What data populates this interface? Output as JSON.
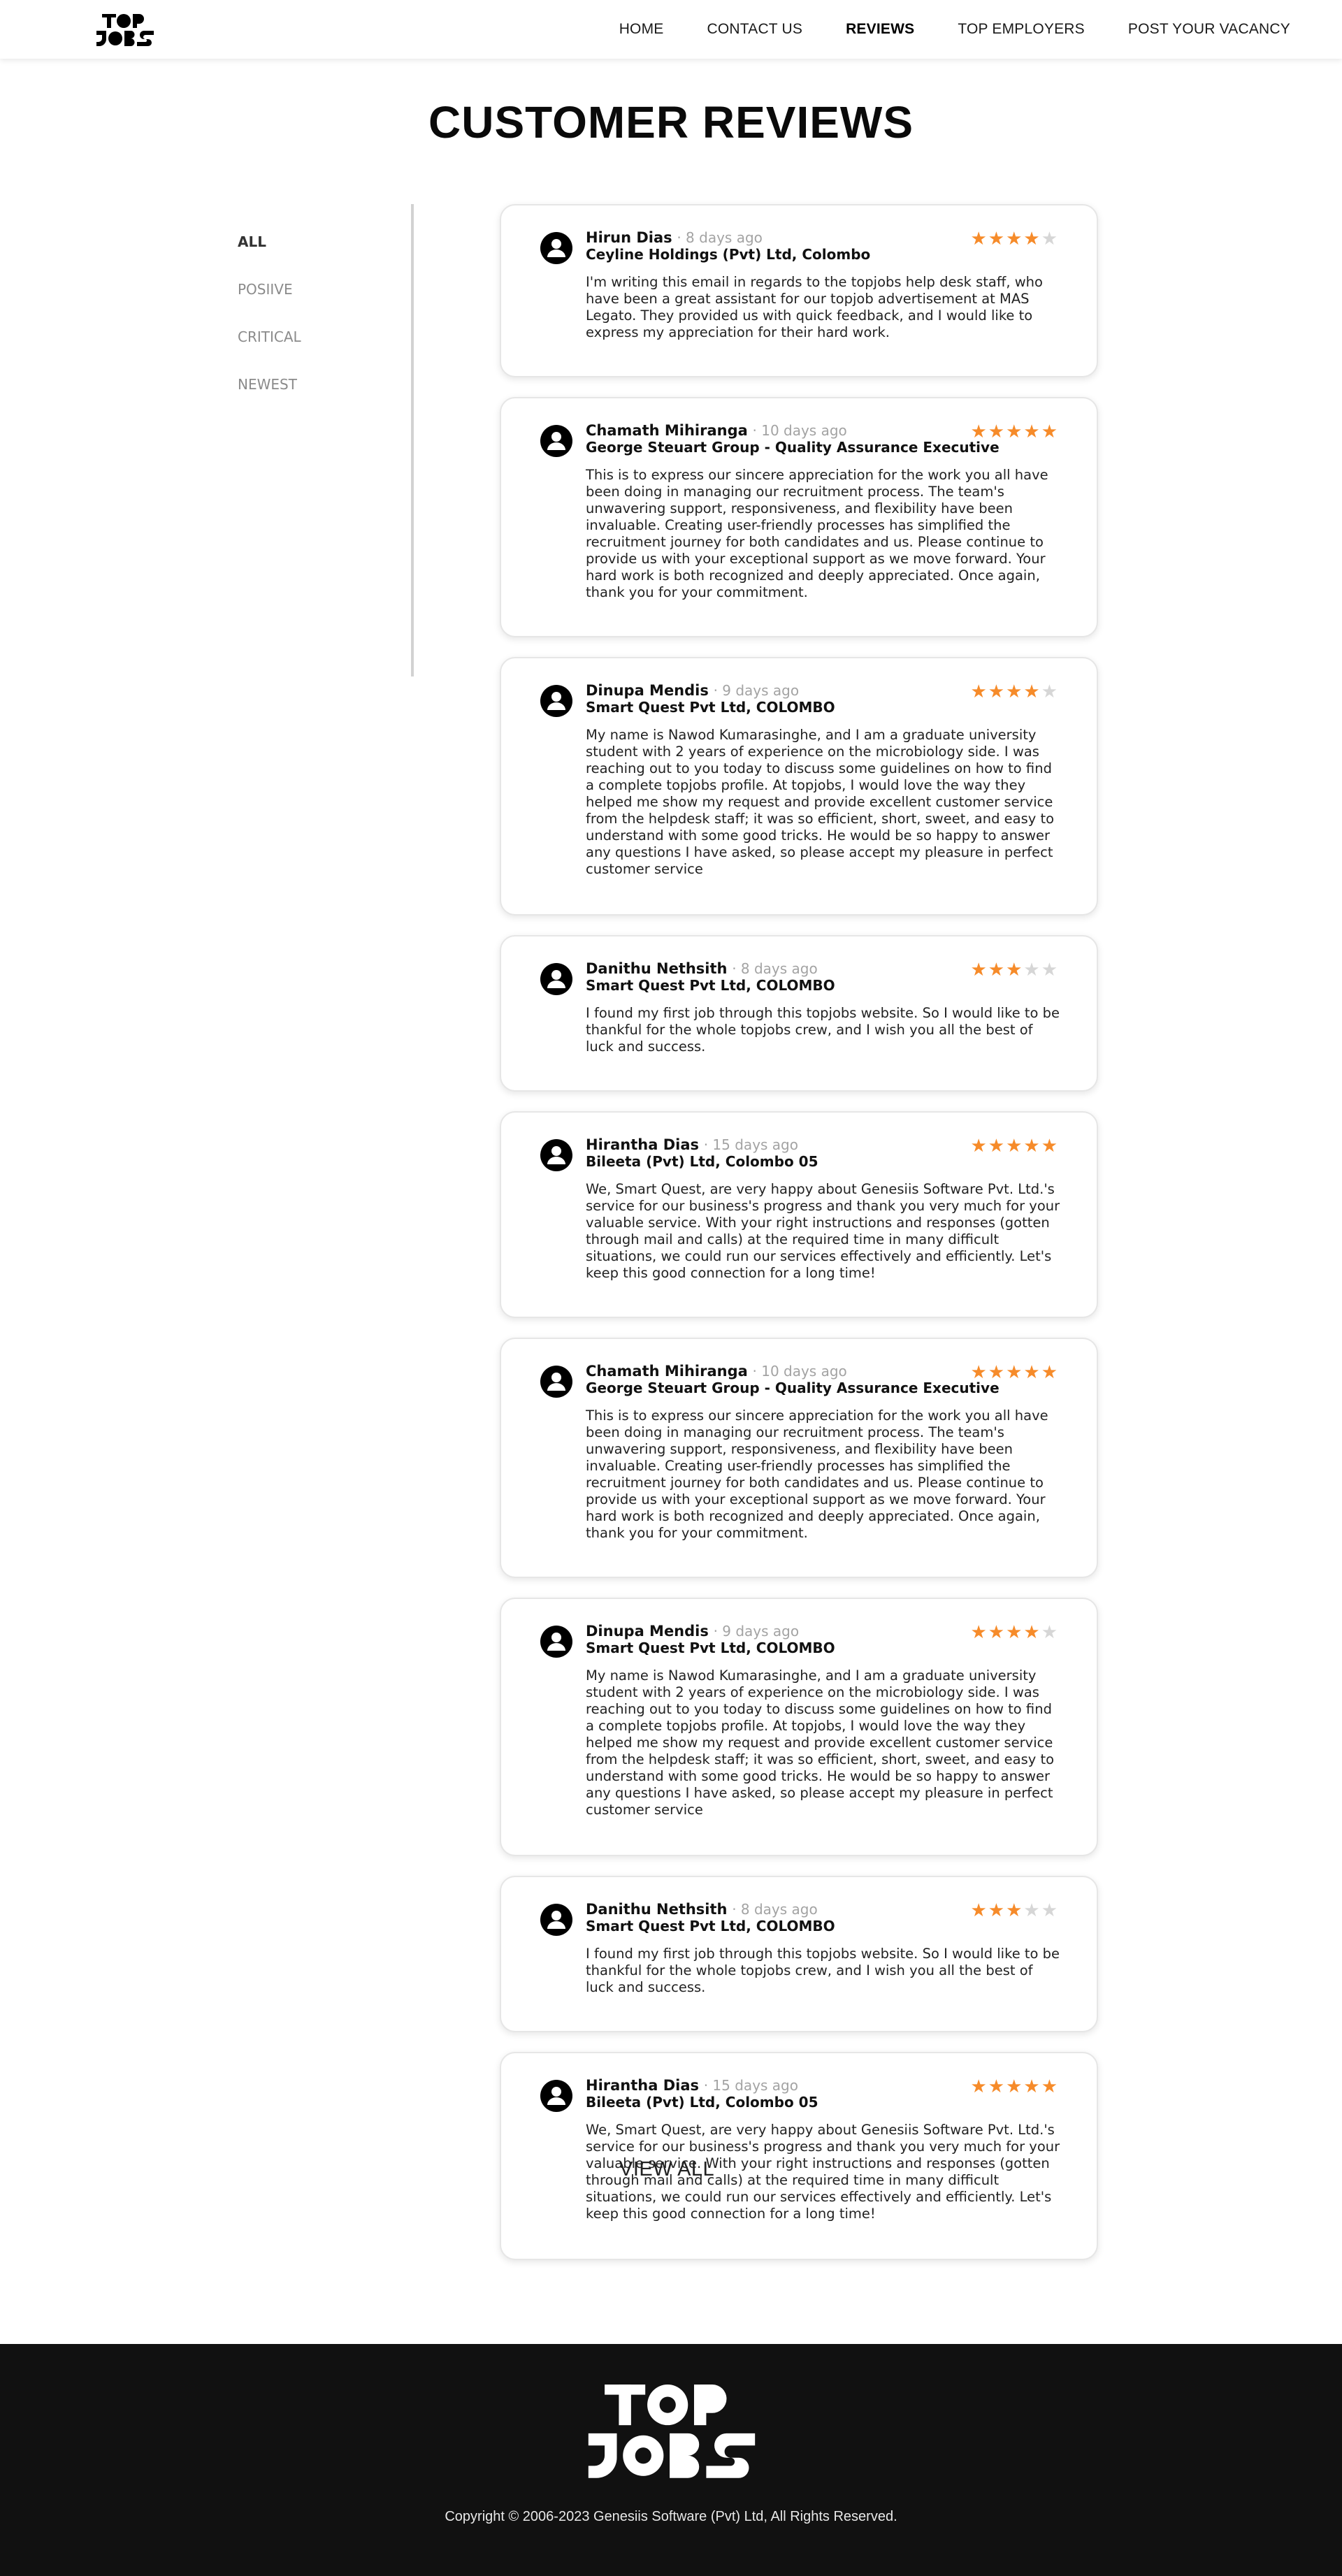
{
  "header": {
    "logo_text": "TOP JOBS",
    "nav": [
      {
        "label": "HOME",
        "active": false
      },
      {
        "label": "CONTACT US",
        "active": false
      },
      {
        "label": "REVIEWS",
        "active": true
      },
      {
        "label": "TOP EMPLOYERS",
        "active": false
      },
      {
        "label": "POST YOUR VACANCY",
        "active": false
      }
    ]
  },
  "page_title": "CUSTOMER REVIEWS",
  "filters": [
    {
      "label": "ALL",
      "active": true
    },
    {
      "label": "POSIIVE",
      "active": false
    },
    {
      "label": "CRITICAL",
      "active": false
    },
    {
      "label": "NEWEST",
      "active": false
    }
  ],
  "reviews": [
    {
      "name": "Hirun Dias",
      "ago": "· 8 days ago",
      "company": "Ceyline Holdings (Pvt) Ltd, Colombo",
      "rating": 4,
      "text": "I'm writing this email in regards to the topjobs help desk staff, who have been a great assistant for our topjob advertisement at MAS Legato. They provided us with quick feedback, and I would like to express my appreciation for their hard work."
    },
    {
      "name": "Chamath Mihiranga",
      "ago": "· 10 days ago",
      "company": "George Steuart Group - Quality Assurance Executive",
      "rating": 5,
      "text": "This is to express our sincere appreciation for the work you all have been doing in managing our recruitment process. The team's unwavering support, responsiveness, and flexibility have been invaluable. Creating user-friendly processes has simplified the recruitment journey for both candidates and us. Please continue to provide us with your exceptional support as we move forward. Your hard work is both recognized and deeply appreciated. Once again, thank you for your commitment."
    },
    {
      "name": "Dinupa Mendis",
      "ago": "· 9 days ago",
      "company": "Smart Quest Pvt Ltd, COLOMBO",
      "rating": 4,
      "text": "My name is Nawod Kumarasinghe, and I am a graduate university student with 2 years of experience on the microbiology side. I was reaching out to you today to discuss some guidelines on how to find a complete topjobs profile. At topjobs, I would love the way they helped me show my request and provide excellent customer service from the helpdesk staff; it was so efficient, short, sweet, and easy to understand with some good tricks. He would be so happy to answer any questions I have asked, so please accept my pleasure in perfect customer service"
    },
    {
      "name": "Danithu Nethsith",
      "ago": "· 8 days ago",
      "company": "Smart Quest Pvt Ltd, COLOMBO",
      "rating": 3,
      "text": "I found my first job through this topjobs website. So I would like to be thankful for the whole topjobs crew, and I wish you all the best of luck and success."
    },
    {
      "name": "Hirantha Dias",
      "ago": "· 15 days ago",
      "company": "Bileeta (Pvt) Ltd, Colombo 05",
      "rating": 5,
      "text": "We, Smart Quest, are very happy about Genesiis Software Pvt. Ltd.'s service for our business's progress and thank you very much for your valuable service. With your right instructions and responses (gotten through mail and calls) at the required time in many difficult situations, we could run our services effectively and efficiently. Let's keep this good connection for a long time!"
    },
    {
      "name": "Chamath Mihiranga",
      "ago": "· 10 days ago",
      "company": "George Steuart Group - Quality Assurance Executive",
      "rating": 5,
      "text": "This is to express our sincere appreciation for the work you all have been doing in managing our recruitment process. The team's unwavering support, responsiveness, and flexibility have been invaluable. Creating user-friendly processes has simplified the recruitment journey for both candidates and us. Please continue to provide us with your exceptional support as we move forward. Your hard work is both recognized and deeply appreciated. Once again, thank you for your commitment."
    },
    {
      "name": "Dinupa Mendis",
      "ago": "· 9 days ago",
      "company": "Smart Quest Pvt Ltd, COLOMBO",
      "rating": 4,
      "text": "My name is Nawod Kumarasinghe, and I am a graduate university student with 2 years of experience on the microbiology side. I was reaching out to you today to discuss some guidelines on how to find a complete topjobs profile. At topjobs, I would love the way they helped me show my request and provide excellent customer service from the helpdesk staff; it was so efficient, short, sweet, and easy to understand with some good tricks. He would be so happy to answer any questions I have asked, so please accept my pleasure in perfect customer service"
    },
    {
      "name": "Danithu Nethsith",
      "ago": "· 8 days ago",
      "company": "Smart Quest Pvt Ltd, COLOMBO",
      "rating": 3,
      "text": "I found my first job through this topjobs website. So I would like to be thankful for the whole topjobs crew, and I wish you all the best of luck and success."
    },
    {
      "name": "Hirantha Dias",
      "ago": "· 15 days ago",
      "company": "Bileeta (Pvt) Ltd, Colombo 05",
      "rating": 5,
      "text": "We, Smart Quest, are very happy about Genesiis Software Pvt. Ltd.'s service for our business's progress and thank you very much for your valuable service. With your right instructions and responses (gotten through mail and calls) at the required time in many difficult situations, we could run our services effectively and efficiently. Let's keep this good connection for a long time!"
    }
  ],
  "rating_max": 5,
  "view_all_label": "VIEW ALL",
  "footer": {
    "logo_text": "TOP JOBS",
    "copyright": "Copyright © 2006-2023 Genesiis Software (Pvt) Ltd, All Rights Reserved."
  },
  "colors": {
    "star_on": "#f68b2a",
    "star_off": "#d6d6d6",
    "footer_bg": "#111111"
  }
}
